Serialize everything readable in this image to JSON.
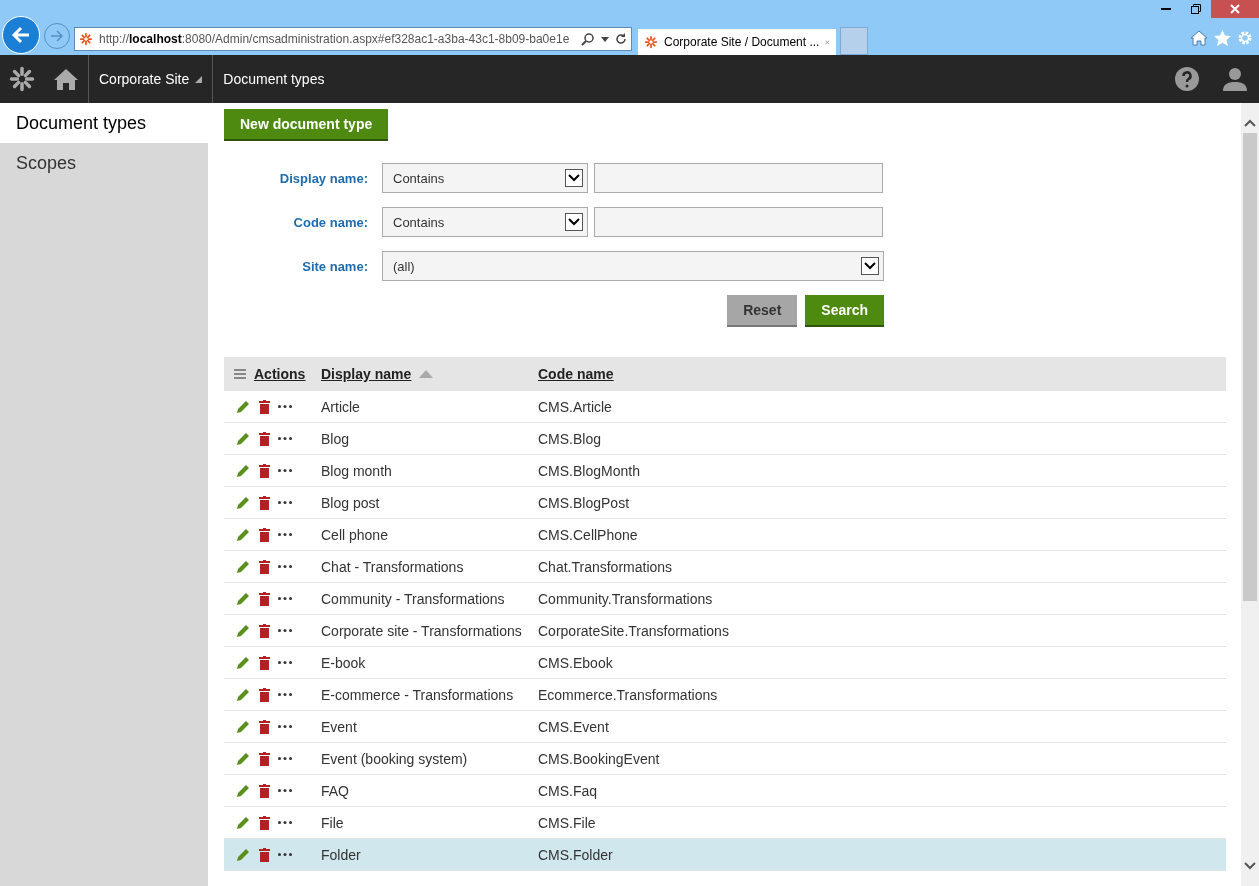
{
  "browser": {
    "address": "http://**localhost**:8080/Admin/cmsadministration.aspx#ef328ac1-a3ba-43c1-8b09-ba0e1e",
    "tab_title": "Corporate Site / Document ..."
  },
  "header": {
    "site": "Corporate Site",
    "page": "Document types"
  },
  "sidebar": {
    "items": [
      {
        "label": "Document types",
        "selected": true
      },
      {
        "label": "Scopes",
        "selected": false
      }
    ]
  },
  "new_button": "New document type",
  "filter": {
    "rows": [
      {
        "label": "Display name:",
        "kind": "text",
        "operator": "Contains",
        "value": ""
      },
      {
        "label": "Code name:",
        "kind": "text",
        "operator": "Contains",
        "value": ""
      },
      {
        "label": "Site name:",
        "kind": "select",
        "value": "(all)"
      }
    ],
    "buttons": [
      {
        "label": "Reset",
        "kind": "secondary"
      },
      {
        "label": "Search",
        "kind": "primary"
      }
    ]
  },
  "table": {
    "columns": [
      {
        "label": "Actions",
        "sorted": false
      },
      {
        "label": "Display name",
        "sorted": true
      },
      {
        "label": "Code name",
        "sorted": false
      }
    ],
    "rows": [
      {
        "display_name": "Article",
        "code_name": "CMS.Article",
        "selected": false
      },
      {
        "display_name": "Blog",
        "code_name": "CMS.Blog",
        "selected": false
      },
      {
        "display_name": "Blog month",
        "code_name": "CMS.BlogMonth",
        "selected": false
      },
      {
        "display_name": "Blog post",
        "code_name": "CMS.BlogPost",
        "selected": false
      },
      {
        "display_name": "Cell phone",
        "code_name": "CMS.CellPhone",
        "selected": false
      },
      {
        "display_name": "Chat - Transformations",
        "code_name": "Chat.Transformations",
        "selected": false
      },
      {
        "display_name": "Community - Transformations",
        "code_name": "Community.Transformations",
        "selected": false
      },
      {
        "display_name": "Corporate site - Transformations",
        "code_name": "CorporateSite.Transformations",
        "selected": false
      },
      {
        "display_name": "E-book",
        "code_name": "CMS.Ebook",
        "selected": false
      },
      {
        "display_name": "E-commerce - Transformations",
        "code_name": "Ecommerce.Transformations",
        "selected": false
      },
      {
        "display_name": "Event",
        "code_name": "CMS.Event",
        "selected": false
      },
      {
        "display_name": "Event (booking system)",
        "code_name": "CMS.BookingEvent",
        "selected": false
      },
      {
        "display_name": "FAQ",
        "code_name": "CMS.Faq",
        "selected": false
      },
      {
        "display_name": "File",
        "code_name": "CMS.File",
        "selected": false
      },
      {
        "display_name": "Folder",
        "code_name": "CMS.Folder",
        "selected": true
      }
    ]
  }
}
